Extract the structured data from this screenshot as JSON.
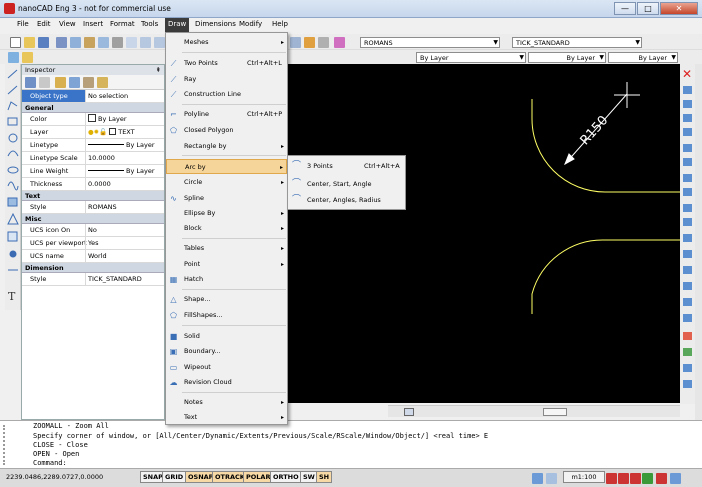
{
  "window": {
    "title": "nanoCAD Eng 3 - not for commercial use",
    "min": "—",
    "max": "□",
    "close": "✕"
  },
  "menubar": [
    "File",
    "Edit",
    "View",
    "Insert",
    "Format",
    "Tools",
    "Draw",
    "Dimensions",
    "Modify",
    "Help"
  ],
  "active_menu": "Draw",
  "toolbar": {
    "text_style": "ROMANS",
    "dim_style": "TICK_STANDARD"
  },
  "properties_bar": {
    "color": "By Layer",
    "linetype": "By Layer",
    "lineweight": "By Layer"
  },
  "inspector": {
    "title": "Inspector",
    "pin": "⇞",
    "object_type_key": "Object type",
    "object_type_val": "No selection",
    "general_title": "General",
    "general": [
      {
        "k": "Color",
        "v": "By Layer"
      },
      {
        "k": "Layer",
        "v": "TEXT"
      },
      {
        "k": "Linetype",
        "v": "By Layer"
      },
      {
        "k": "Linetype Scale",
        "v": "10.0000"
      },
      {
        "k": "Line Weight",
        "v": "By Layer"
      },
      {
        "k": "Thickness",
        "v": "0.0000"
      }
    ],
    "text_title": "Text",
    "text": [
      {
        "k": "Style",
        "v": "ROMANS"
      }
    ],
    "misc_title": "Misc",
    "misc": [
      {
        "k": "UCS icon On",
        "v": "No"
      },
      {
        "k": "UCS per viewport",
        "v": "Yes"
      },
      {
        "k": "UCS name",
        "v": "World"
      }
    ],
    "dim_title": "Dimension",
    "dim": [
      {
        "k": "Style",
        "v": "TICK_STANDARD"
      }
    ]
  },
  "canvas": {
    "dimension_label": "R150",
    "bg": "#000000",
    "curve_color": "#ffff66"
  },
  "draw_menu": [
    {
      "label": "Meshes",
      "arrow": "▸"
    },
    {
      "label": "Two Points",
      "shortcut": "Ctrl+Alt+L",
      "icon": "⟋"
    },
    {
      "label": "Ray",
      "icon": "⟋"
    },
    {
      "label": "Construction Line",
      "icon": "⟋"
    },
    {
      "label": "Polyline",
      "shortcut": "Ctrl+Alt+P",
      "icon": "⌐"
    },
    {
      "label": "Closed Polygon",
      "icon": "⬠"
    },
    {
      "label": "Rectangle by",
      "arrow": "▸"
    },
    {
      "label": "Arc by",
      "arrow": "▸"
    },
    {
      "label": "Circle",
      "arrow": "▸"
    },
    {
      "label": "Spline",
      "icon": "∿"
    },
    {
      "label": "Ellipse By",
      "arrow": "▸"
    },
    {
      "label": "Block",
      "arrow": "▸"
    },
    {
      "label": "Tables",
      "arrow": "▸"
    },
    {
      "label": "Point",
      "arrow": "▸"
    },
    {
      "label": "Hatch",
      "icon": "▦"
    },
    {
      "label": "Shape...",
      "icon": "△"
    },
    {
      "label": "FillShapes...",
      "icon": "⬠"
    },
    {
      "label": "Solid",
      "icon": "■"
    },
    {
      "label": "Boundary...",
      "icon": "▣"
    },
    {
      "label": "Wipeout",
      "icon": "▭"
    },
    {
      "label": "Revision Cloud",
      "icon": "☁"
    },
    {
      "label": "Notes",
      "arrow": "▸"
    },
    {
      "label": "Text",
      "arrow": "▸"
    }
  ],
  "arc_submenu": [
    {
      "label": "3 Points",
      "shortcut": "Ctrl+Alt+A",
      "icon": "⌒"
    },
    {
      "label": "Center, Start, Angle",
      "icon": "⌒"
    },
    {
      "label": "Center, Angles, Radius",
      "icon": "⌒"
    }
  ],
  "command_lines": [
    "ZOOMALL - Zoom All",
    "Specify corner of window, or [All/Center/Dynamic/Extents/Previous/Scale/RScale/Window/Object/] <real time> E",
    "CLOSE - Close",
    "OPEN - Open",
    "Command:"
  ],
  "status": {
    "coords": "2239.0486,2289.0727,0.0000",
    "buttons": [
      "SNAP",
      "GRID",
      "OSNAP",
      "OTRACK",
      "POLAR",
      "ORTHO",
      "SW",
      "SH"
    ],
    "active_buttons": [
      "OSNAP",
      "OTRACK",
      "POLAR",
      "SH"
    ],
    "scale": "m1:100"
  }
}
